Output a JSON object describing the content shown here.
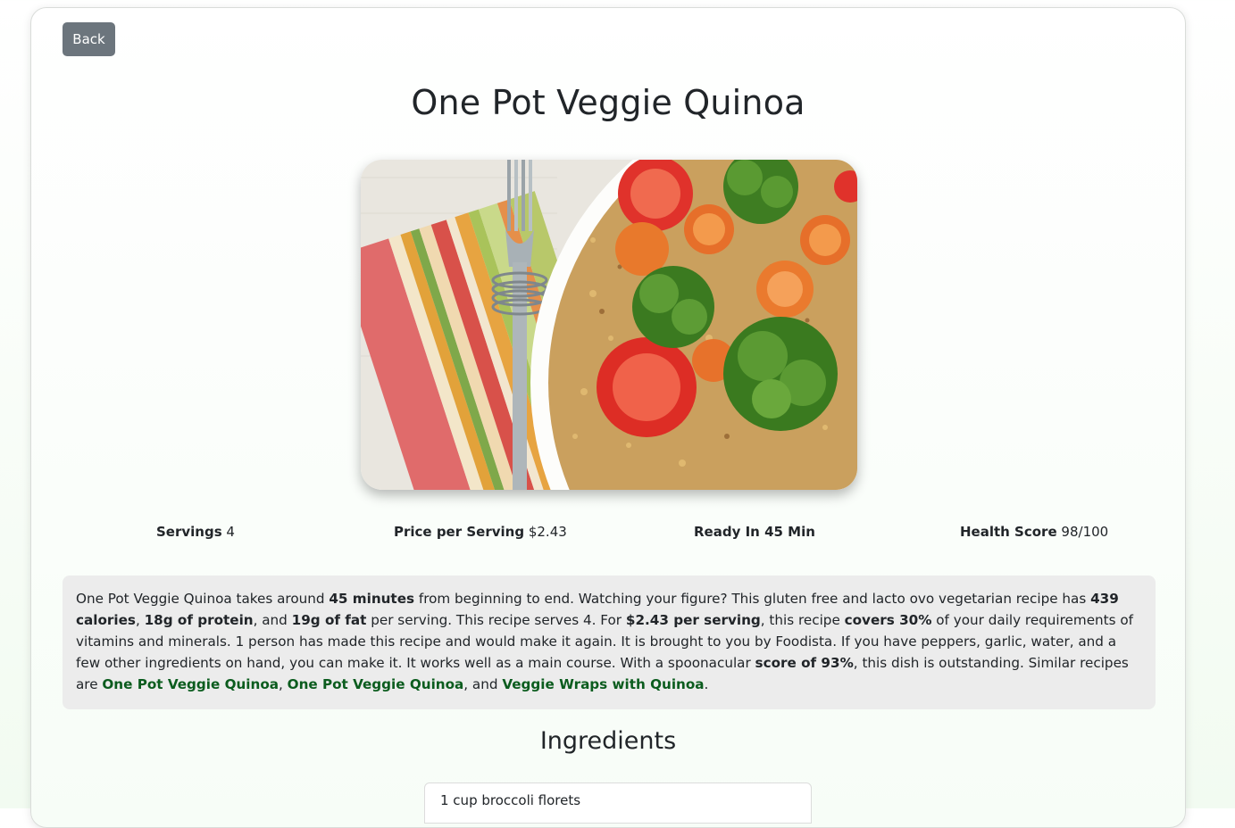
{
  "back_label": "Back",
  "title": "One Pot Veggie Quinoa",
  "image_alt": "One Pot Veggie Quinoa",
  "stats": {
    "servings_label": "Servings",
    "servings_value": "4",
    "price_label": "Price per Serving",
    "price_value": "$2.43",
    "ready_label": "Ready In 45 Min",
    "health_label": "Health Score",
    "health_value": "98/100"
  },
  "summary": {
    "t1": "One Pot Veggie Quinoa takes around ",
    "b1": "45 minutes",
    "t2": " from beginning to end. Watching your figure? This gluten free and lacto ovo vegetarian recipe has ",
    "b2": "439 calories",
    "t3": ", ",
    "b3": "18g of protein",
    "t4": ", and ",
    "b4": "19g of fat",
    "t5": " per serving. This recipe serves 4. For ",
    "b5": "$2.43 per serving",
    "t6": ", this recipe ",
    "b6": "covers 30%",
    "t7": " of your daily requirements of vitamins and minerals. 1 person has made this recipe and would make it again. It is brought to you by Foodista. If you have peppers, garlic, water, and a few other ingredients on hand, you can make it. It works well as a main course. With a spoonacular ",
    "b7": "score of 93%",
    "t8": ", this dish is outstanding. Similar recipes are ",
    "link1": "One Pot Veggie Quinoa",
    "t9": ", ",
    "link2": "One Pot Veggie Quinoa",
    "t10": ", and ",
    "link3": "Veggie Wraps with Quinoa",
    "t11": "."
  },
  "ingredients_title": "Ingredients",
  "ingredients": [
    "1 cup broccoli florets"
  ]
}
